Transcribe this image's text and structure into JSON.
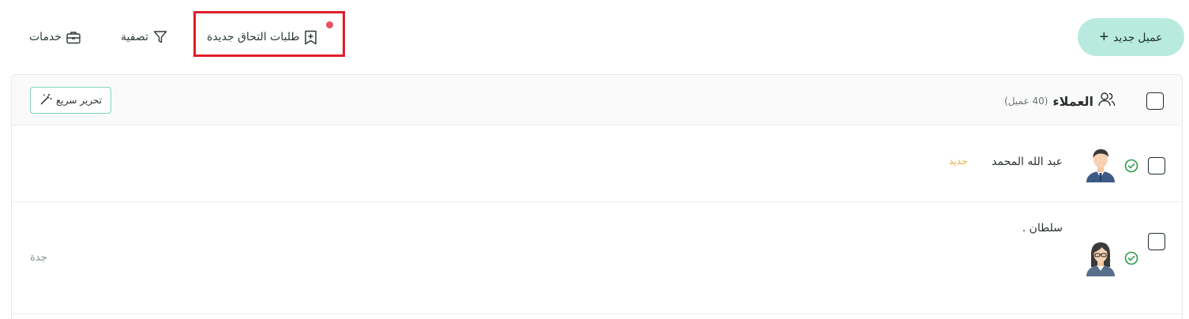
{
  "toolbar": {
    "new_client_label": "عميل جديد",
    "verify_requests_label": "طلبات التحاق جديدة",
    "filter_label": "تصفية",
    "services_label": "خدمات"
  },
  "clients": {
    "title": "العملاء",
    "count_label": "(40 عميل)",
    "quick_edit_label": "تحرير سريع",
    "rows": [
      {
        "name": "عبد الله المحمد",
        "badge": "جديد",
        "city": ""
      },
      {
        "name": "سلطان .",
        "badge": "",
        "city": "جدة"
      }
    ]
  },
  "colors": {
    "accent": "#b8ebdd",
    "highlight": "#e11d2a",
    "notification": "#e8525f",
    "badge_new": "#e8a93a",
    "verified": "#2e9b4a"
  },
  "icons": [
    "plus-icon",
    "bookmark-plus-icon",
    "filter-icon",
    "briefcase-icon",
    "users-icon",
    "magic-wand-icon",
    "check-circle-icon",
    "male-avatar",
    "female-avatar"
  ]
}
